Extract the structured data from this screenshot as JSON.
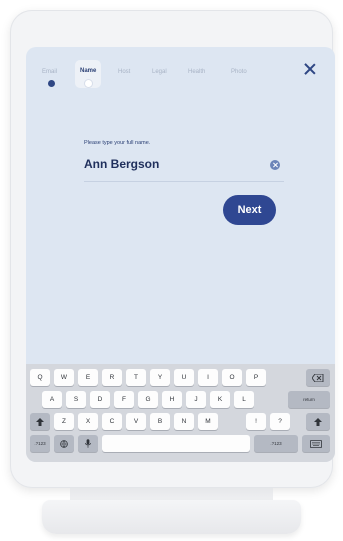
{
  "tabs": [
    {
      "label": "Email",
      "state": "completed"
    },
    {
      "label": "Name",
      "state": "active"
    },
    {
      "label": "Host",
      "state": "pending"
    },
    {
      "label": "Legal",
      "state": "pending"
    },
    {
      "label": "Health",
      "state": "pending"
    },
    {
      "label": "Photo",
      "state": "pending"
    }
  ],
  "form": {
    "prompt": "Please type your full name.",
    "value": "Ann Bergson",
    "next_label": "Next"
  },
  "keyboard": {
    "row1": [
      "Q",
      "W",
      "E",
      "R",
      "T",
      "Y",
      "U",
      "I",
      "O",
      "P"
    ],
    "row2": [
      "A",
      "S",
      "D",
      "F",
      "G",
      "H",
      "J",
      "K",
      "L"
    ],
    "row3": [
      "Z",
      "X",
      "C",
      "V",
      "B",
      "N",
      "M",
      "!",
      "?"
    ],
    "return_label": "return",
    "numbers_label": ".?123",
    "numbers_label_right": ".?123"
  },
  "colors": {
    "accent": "#2f4792",
    "screen_bg": "#dde6f2",
    "step_done": "#2f4784"
  }
}
